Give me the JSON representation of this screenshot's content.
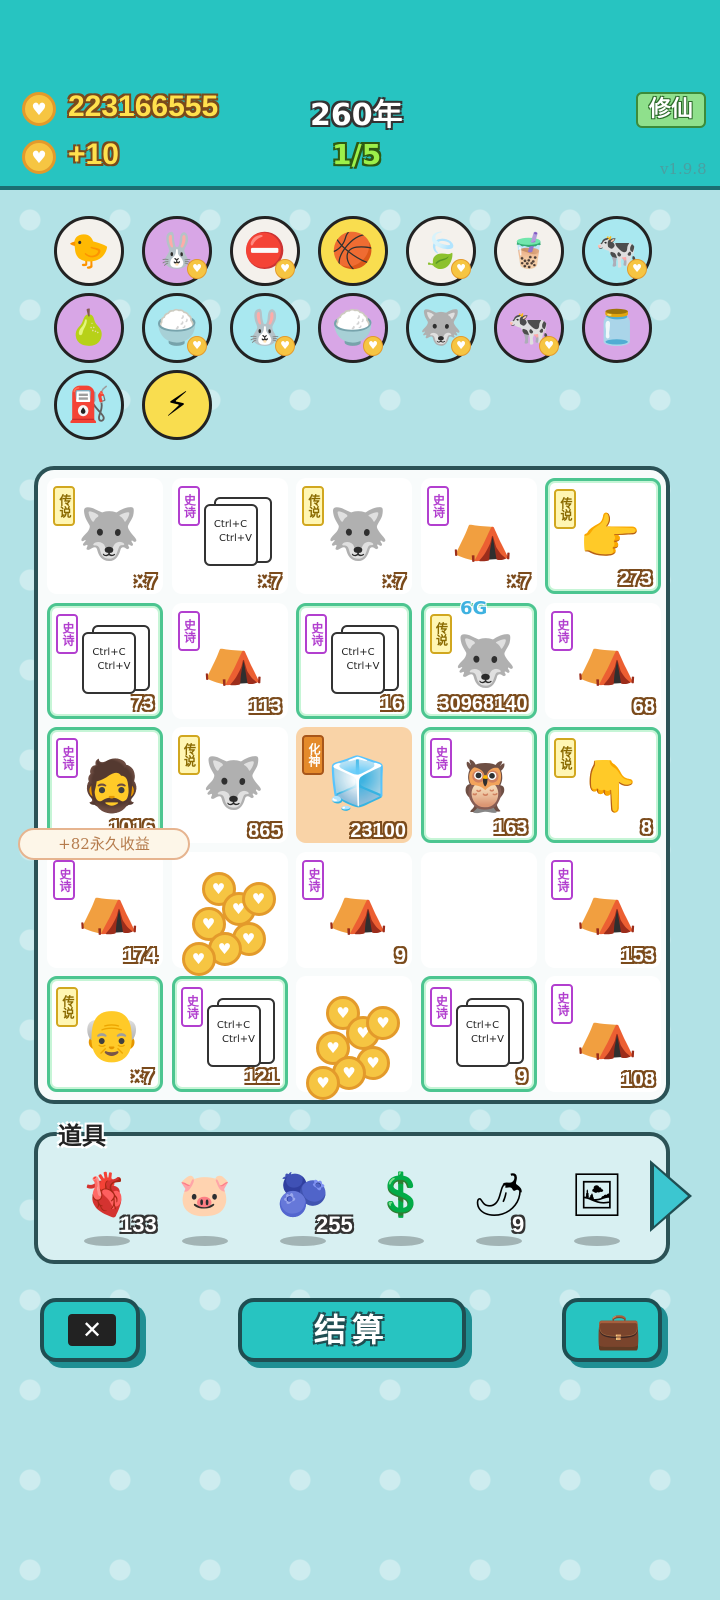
{
  "header": {
    "coins": "223166555",
    "income": "+10",
    "years": "260年",
    "progress": "1/5",
    "cultivate_label": "修仙",
    "version": "v1.9.8"
  },
  "collection": [
    {
      "icon": "chick-icon",
      "glyph": "🐤",
      "bg": "c-white",
      "badge": false
    },
    {
      "icon": "rabbit-icon",
      "glyph": "🐰",
      "bg": "c-purple",
      "badge": true
    },
    {
      "icon": "no-entry-icon",
      "glyph": "⛔",
      "bg": "c-white",
      "badge": true
    },
    {
      "icon": "basketballs-icon",
      "glyph": "🏀",
      "bg": "c-yellow",
      "badge": false
    },
    {
      "icon": "leaf-icon",
      "glyph": "🍃",
      "bg": "c-white",
      "badge": true
    },
    {
      "icon": "milk-tea-icon",
      "glyph": "🧋",
      "bg": "c-white",
      "badge": false
    },
    {
      "icon": "cows-icon",
      "glyph": "🐄",
      "bg": "c-cyan",
      "badge": true
    },
    {
      "icon": "pomelo-icon",
      "glyph": "🍐",
      "bg": "c-purple",
      "badge": false
    },
    {
      "icon": "rice-bowl-icon",
      "glyph": "🍚",
      "bg": "c-cyan",
      "badge": true
    },
    {
      "icon": "rabbit-icon",
      "glyph": "🐰",
      "bg": "c-cyan",
      "badge": true
    },
    {
      "icon": "rice-bowl-icon",
      "glyph": "🍚",
      "bg": "c-purple",
      "badge": true
    },
    {
      "icon": "husky-icon",
      "glyph": "🐺",
      "bg": "c-cyan",
      "badge": true
    },
    {
      "icon": "cows-icon",
      "glyph": "🐄",
      "bg": "c-purple",
      "badge": true
    },
    {
      "icon": "jar-icon",
      "glyph": "🫙",
      "bg": "c-purple",
      "badge": false
    },
    {
      "icon": "pump-icon",
      "glyph": "⛽",
      "bg": "c-cyan",
      "badge": false
    },
    {
      "icon": "lightning-icon",
      "glyph": "⚡",
      "bg": "c-yellow",
      "badge": false
    }
  ],
  "grid": [
    {
      "tag": "传说",
      "tier": "legend",
      "art": "husky-king",
      "glyph": "🐺",
      "count": "×7",
      "glow": false
    },
    {
      "tag": "史诗",
      "tier": "epic",
      "art": "ctrl",
      "count": "×7",
      "glow": false
    },
    {
      "tag": "传说",
      "tier": "legend",
      "art": "husky-king",
      "glyph": "🐺",
      "count": "×7",
      "glow": false
    },
    {
      "tag": "史诗",
      "tier": "epic",
      "art": "rabbit-tent",
      "glyph": "⛺",
      "count": "×7",
      "glow": false
    },
    {
      "tag": "传说",
      "tier": "legend",
      "art": "pointing-hand",
      "glyph": "👉",
      "count": "273",
      "glow": true
    },
    {
      "tag": "史诗",
      "tier": "epic",
      "art": "ctrl",
      "count": "73",
      "glow": true
    },
    {
      "tag": "史诗",
      "tier": "epic",
      "art": "rabbit-tent",
      "glyph": "⛺",
      "count": "113",
      "glow": false
    },
    {
      "tag": "史诗",
      "tier": "epic",
      "art": "ctrl",
      "count": "16",
      "glow": true
    },
    {
      "tag": "传说",
      "tier": "legend",
      "art": "husky-king",
      "glyph": "🐺",
      "count": "30968140",
      "glow": true
    },
    {
      "tag": "史诗",
      "tier": "epic",
      "art": "rabbit-tent",
      "glyph": "⛺",
      "count": "68",
      "glow": false
    },
    {
      "tag": "史诗",
      "tier": "epic",
      "art": "bearded-king",
      "glyph": "🧔",
      "count": "1016",
      "glow": true
    },
    {
      "tag": "传说",
      "tier": "legend",
      "art": "husky-king",
      "glyph": "🐺",
      "count": "865",
      "glow": false
    },
    {
      "tag": "化神",
      "tier": "god",
      "art": "fridge",
      "glyph": "🧊",
      "count": "23100",
      "glow": false,
      "orange": true
    },
    {
      "tag": "史诗",
      "tier": "epic",
      "art": "owl",
      "glyph": "🦉",
      "count": "163",
      "glow": true
    },
    {
      "tag": "传说",
      "tier": "legend",
      "art": "pointing-hand",
      "glyph": "👇",
      "count": "8",
      "glow": true
    },
    {
      "tag": "史诗",
      "tier": "epic",
      "art": "rabbit-tent",
      "glyph": "⛺",
      "count": "174",
      "glow": false
    },
    {
      "tag": "",
      "tier": "",
      "art": "coins",
      "count": "",
      "glow": false
    },
    {
      "tag": "史诗",
      "tier": "epic",
      "art": "rabbit-tent",
      "glyph": "⛺",
      "count": "9",
      "glow": false
    },
    {
      "tag": "",
      "tier": "",
      "art": "empty",
      "count": "",
      "glow": false
    },
    {
      "tag": "史诗",
      "tier": "epic",
      "art": "rabbit-tent",
      "glyph": "⛺",
      "count": "153",
      "glow": false
    },
    {
      "tag": "传说",
      "tier": "legend",
      "art": "old-man",
      "glyph": "👴",
      "count": "×7",
      "glow": true
    },
    {
      "tag": "史诗",
      "tier": "epic",
      "art": "ctrl",
      "count": "121",
      "glow": true
    },
    {
      "tag": "",
      "tier": "",
      "art": "coins",
      "count": "",
      "glow": false
    },
    {
      "tag": "史诗",
      "tier": "epic",
      "art": "ctrl",
      "count": "9",
      "glow": true
    },
    {
      "tag": "史诗",
      "tier": "epic",
      "art": "rabbit-tent",
      "glyph": "⛺",
      "count": "108",
      "glow": false
    }
  ],
  "ctrl_text": {
    "line1": "Ctrl+C",
    "line2": "Ctrl+V"
  },
  "tooltip": "+82永久收益",
  "bonus_6g": "6G",
  "items_title": "道具",
  "items": [
    {
      "icon": "liver-icon",
      "glyph": "🫀",
      "count": "133"
    },
    {
      "icon": "piggy-bank-icon",
      "glyph": "🐷",
      "count": ""
    },
    {
      "icon": "blueberry-icon",
      "glyph": "🫐",
      "count": "255"
    },
    {
      "icon": "dollar-coin-icon",
      "glyph": "💲",
      "count": ""
    },
    {
      "icon": "chili-icon",
      "glyph": "🌶",
      "count": "9"
    },
    {
      "icon": "copy-paste-frame-icon",
      "glyph": "🖼",
      "count": ""
    }
  ],
  "buttons": {
    "settle": "结算"
  }
}
